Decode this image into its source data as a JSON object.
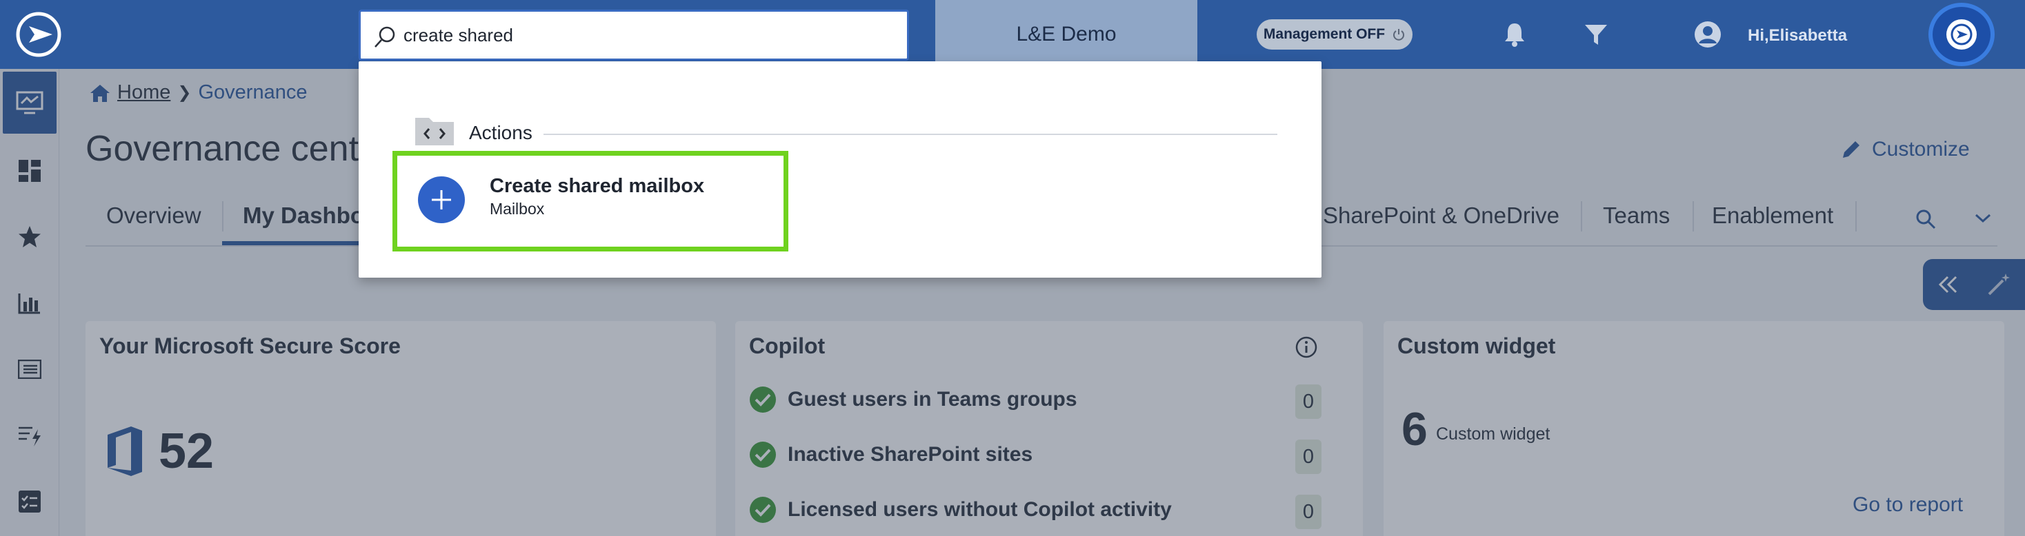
{
  "topbar": {
    "search_value": "create shared",
    "tenant_label": "L&E Demo",
    "management_label": "Management OFF",
    "greeting": "Hi,Elisabetta"
  },
  "breadcrumb": {
    "home": "Home",
    "current": "Governance"
  },
  "page": {
    "title": "Governance center",
    "customize_label": "Customize"
  },
  "tabs": [
    {
      "label": "Overview"
    },
    {
      "label": "My Dashboard"
    },
    {
      "label": "SharePoint & OneDrive"
    },
    {
      "label": "Teams"
    },
    {
      "label": "Enablement"
    }
  ],
  "cards": {
    "secure_score": {
      "title": "Your Microsoft Secure Score",
      "value": "52"
    },
    "copilot": {
      "title": "Copilot",
      "rows": [
        {
          "label": "Guest users in Teams groups",
          "count": "0"
        },
        {
          "label": "Inactive SharePoint sites",
          "count": "0"
        },
        {
          "label": "Licensed users without Copilot activity",
          "count": "0"
        }
      ]
    },
    "custom_widget": {
      "title": "Custom widget",
      "value": "6",
      "label": "Custom widget",
      "link": "Go to report"
    }
  },
  "dropdown": {
    "section_label": "Actions",
    "result": {
      "title": "Create shared mailbox",
      "subtitle": "Mailbox"
    }
  },
  "colors": {
    "brand_blue": "#2d5a9e",
    "highlight_green": "#6fd21f",
    "check_green": "#3f9a3a"
  }
}
